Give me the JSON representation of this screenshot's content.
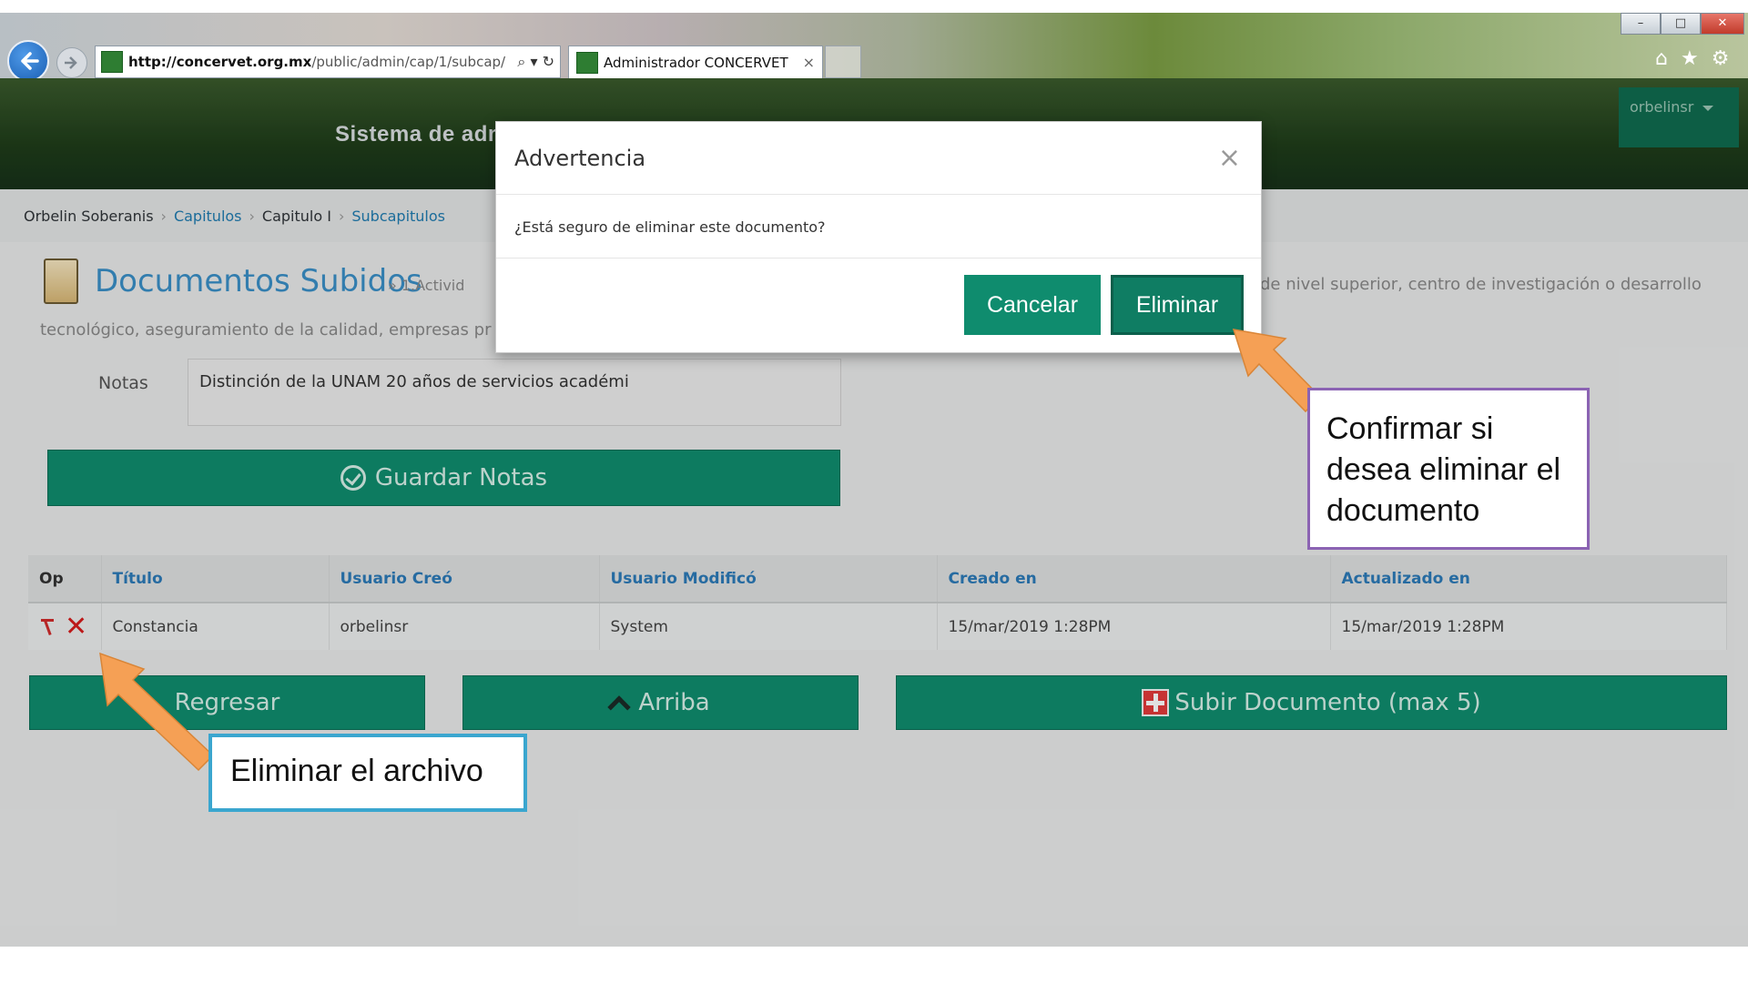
{
  "browser": {
    "url_domain": "http://concervet.org.mx",
    "url_path": "/public/admin/cap/1/subcap/",
    "tab_title": "Administrador CONCERVET",
    "tab_close": "×"
  },
  "header": {
    "title": "Sistema de adm",
    "user": "orbelinsr"
  },
  "breadcrumb": {
    "user": "Orbelin Soberanis",
    "items": [
      "Capitulos",
      "Capitulo I",
      "Subcapitulos"
    ]
  },
  "page": {
    "title": "Documentos Subidos",
    "subtitle_left": "» 1.Activid",
    "subtitle_right": "de nivel superior, centro de investigación o desarrollo",
    "line2": "tecnológico, aseguramiento de la calidad, empresas pr",
    "notes_label": "Notas",
    "notes_value": "Distinción de la UNAM 20 años de servicios académi",
    "save_notes_label": "Guardar Notas"
  },
  "table": {
    "headers": [
      "Op",
      "Título",
      "Usuario Creó",
      "Usuario Modificó",
      "Creado en",
      "Actualizado en"
    ],
    "rows": [
      {
        "titulo": "Constancia",
        "creo": "orbelinsr",
        "modifico": "System",
        "creado": "15/mar/2019 1:28PM",
        "actualizado": "15/mar/2019 1:28PM"
      }
    ]
  },
  "buttons": {
    "back": "Regresar",
    "up": "Arriba",
    "upload": "Subir Documento (max 5)"
  },
  "modal": {
    "title": "Advertencia",
    "close": "×",
    "message": "¿Está seguro de eliminar este documento?",
    "cancel": "Cancelar",
    "confirm": "Eliminar"
  },
  "annotations": {
    "confirm_note": "Confirmar si desea eliminar el documento",
    "delete_note": "Eliminar el archivo"
  },
  "colors": {
    "accent_green": "#0f8c6e",
    "link_blue": "#1f7bb0",
    "arrow_orange": "#f5a055",
    "delete_red": "#d71d1d"
  }
}
